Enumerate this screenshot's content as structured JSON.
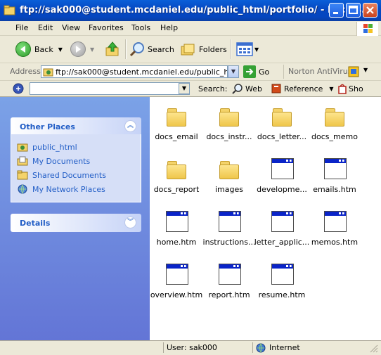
{
  "window": {
    "title": "ftp://sak000@student.mcdaniel.edu/public_html/portfolio/ - Micros..."
  },
  "menubar": [
    "File",
    "Edit",
    "View",
    "Favorites",
    "Tools",
    "Help"
  ],
  "toolbar": {
    "back_label": "Back",
    "search_label": "Search",
    "folders_label": "Folders"
  },
  "addressbar": {
    "label": "Address",
    "value": "ftp://sak000@student.mcdaniel.edu/public_html/p",
    "go_label": "Go",
    "norton_label": "Norton AntiVirus"
  },
  "searchbar": {
    "search_label": "Search:",
    "web_label": "Web",
    "reference_label": "Reference",
    "shop_label": "Sho"
  },
  "taskpane": {
    "other_places_title": "Other Places",
    "places": [
      {
        "label": "public_html",
        "icon": "ftp-folder-icon"
      },
      {
        "label": "My Documents",
        "icon": "my-documents-icon"
      },
      {
        "label": "Shared Documents",
        "icon": "shared-documents-icon"
      },
      {
        "label": "My Network Places",
        "icon": "network-places-icon"
      }
    ],
    "details_title": "Details"
  },
  "files": [
    {
      "name": "docs_email",
      "type": "folder"
    },
    {
      "name": "docs_instr...",
      "type": "folder"
    },
    {
      "name": "docs_letter...",
      "type": "folder"
    },
    {
      "name": "docs_memo",
      "type": "folder"
    },
    {
      "name": "docs_report",
      "type": "folder"
    },
    {
      "name": "images",
      "type": "folder"
    },
    {
      "name": "developme...",
      "type": "htm"
    },
    {
      "name": "emails.htm",
      "type": "htm"
    },
    {
      "name": "home.htm",
      "type": "htm"
    },
    {
      "name": "instructions...",
      "type": "htm"
    },
    {
      "name": "letter_applic...",
      "type": "htm"
    },
    {
      "name": "memos.htm",
      "type": "htm"
    },
    {
      "name": "overview.htm",
      "type": "htm"
    },
    {
      "name": "report.htm",
      "type": "htm"
    },
    {
      "name": "resume.htm",
      "type": "htm"
    }
  ],
  "statusbar": {
    "user": "User: sak000",
    "zone": "Internet"
  },
  "colors": {
    "titlebar": "#0548c2",
    "taskpane_link": "#215dc6",
    "chrome": "#ece9d8"
  }
}
